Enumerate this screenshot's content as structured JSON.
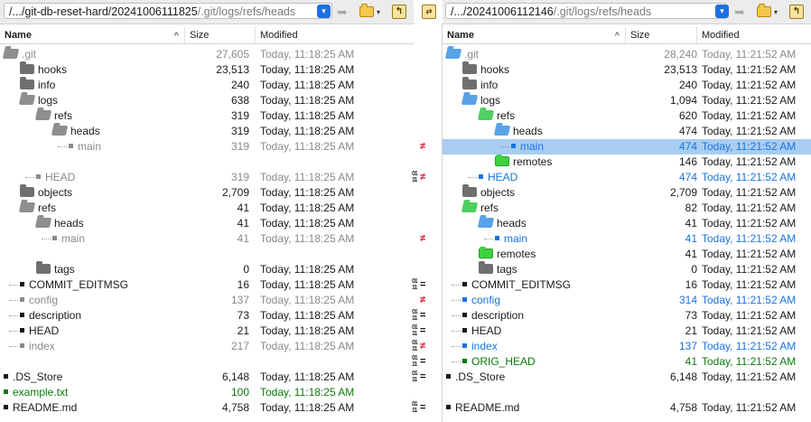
{
  "left_pane": {
    "path_prefix": "/.../git-db-reset-hard/20241006111825",
    "path_suffix": "/.git/logs/refs/heads",
    "rows": [
      {
        "name": ".git",
        "size": "27,605",
        "mod": "Today, 11:18:25 AM",
        "kind": "folder-open",
        "depth": 0,
        "style": "gray"
      },
      {
        "name": "hooks",
        "size": "23,513",
        "mod": "Today, 11:18:25 AM",
        "kind": "folder",
        "depth": 1,
        "style": "normal"
      },
      {
        "name": "info",
        "size": "240",
        "mod": "Today, 11:18:25 AM",
        "kind": "folder",
        "depth": 1,
        "style": "normal"
      },
      {
        "name": "logs",
        "size": "638",
        "mod": "Today, 11:18:25 AM",
        "kind": "folder-open",
        "depth": 1,
        "style": "normal"
      },
      {
        "name": "refs",
        "size": "319",
        "mod": "Today, 11:18:25 AM",
        "kind": "folder-open",
        "depth": 2,
        "style": "normal"
      },
      {
        "name": "heads",
        "size": "319",
        "mod": "Today, 11:18:25 AM",
        "kind": "folder-open",
        "depth": 3,
        "style": "normal"
      },
      {
        "name": "main",
        "size": "319",
        "mod": "Today, 11:18:25 AM",
        "kind": "file",
        "depth": 4,
        "style": "gray"
      },
      {
        "name": "",
        "size": "",
        "mod": "",
        "kind": "empty",
        "depth": 0,
        "style": "normal"
      },
      {
        "name": "HEAD",
        "size": "319",
        "mod": "Today, 11:18:25 AM",
        "kind": "file",
        "depth": 2,
        "style": "gray"
      },
      {
        "name": "objects",
        "size": "2,709",
        "mod": "Today, 11:18:25 AM",
        "kind": "folder",
        "depth": 1,
        "style": "normal"
      },
      {
        "name": "refs",
        "size": "41",
        "mod": "Today, 11:18:25 AM",
        "kind": "folder-open",
        "depth": 1,
        "style": "normal"
      },
      {
        "name": "heads",
        "size": "41",
        "mod": "Today, 11:18:25 AM",
        "kind": "folder-open",
        "depth": 2,
        "style": "normal"
      },
      {
        "name": "main",
        "size": "41",
        "mod": "Today, 11:18:25 AM",
        "kind": "file",
        "depth": 3,
        "style": "gray"
      },
      {
        "name": "",
        "size": "",
        "mod": "",
        "kind": "empty",
        "depth": 0,
        "style": "normal"
      },
      {
        "name": "tags",
        "size": "0",
        "mod": "Today, 11:18:25 AM",
        "kind": "folder",
        "depth": 2,
        "style": "normal"
      },
      {
        "name": "COMMIT_EDITMSG",
        "size": "16",
        "mod": "Today, 11:18:25 AM",
        "kind": "file",
        "depth": 1,
        "style": "normal"
      },
      {
        "name": "config",
        "size": "137",
        "mod": "Today, 11:18:25 AM",
        "kind": "file",
        "depth": 1,
        "style": "gray"
      },
      {
        "name": "description",
        "size": "73",
        "mod": "Today, 11:18:25 AM",
        "kind": "file",
        "depth": 1,
        "style": "normal"
      },
      {
        "name": "HEAD",
        "size": "21",
        "mod": "Today, 11:18:25 AM",
        "kind": "file",
        "depth": 1,
        "style": "normal"
      },
      {
        "name": "index",
        "size": "217",
        "mod": "Today, 11:18:25 AM",
        "kind": "file",
        "depth": 1,
        "style": "gray"
      },
      {
        "name": "",
        "size": "",
        "mod": "",
        "kind": "empty",
        "depth": 0,
        "style": "normal"
      },
      {
        "name": ".DS_Store",
        "size": "6,148",
        "mod": "Today, 11:18:25 AM",
        "kind": "file",
        "depth": 0,
        "style": "normal"
      },
      {
        "name": "example.txt",
        "size": "100",
        "mod": "Today, 11:18:25 AM",
        "kind": "file",
        "depth": 0,
        "style": "green"
      },
      {
        "name": "README.md",
        "size": "4,758",
        "mod": "Today, 11:18:25 AM",
        "kind": "file",
        "depth": 0,
        "style": "normal"
      }
    ]
  },
  "right_pane": {
    "path_prefix": "/.../20241006112146",
    "path_suffix": "/.git/logs/refs/heads",
    "rows": [
      {
        "name": ".git",
        "size": "28,240",
        "mod": "Today, 11:21:52 AM",
        "kind": "folder-open-blue",
        "depth": 0,
        "style": "gray"
      },
      {
        "name": "hooks",
        "size": "23,513",
        "mod": "Today, 11:21:52 AM",
        "kind": "folder",
        "depth": 1,
        "style": "normal"
      },
      {
        "name": "info",
        "size": "240",
        "mod": "Today, 11:21:52 AM",
        "kind": "folder",
        "depth": 1,
        "style": "normal"
      },
      {
        "name": "logs",
        "size": "1,094",
        "mod": "Today, 11:21:52 AM",
        "kind": "folder-open-blue",
        "depth": 1,
        "style": "normal"
      },
      {
        "name": "refs",
        "size": "620",
        "mod": "Today, 11:21:52 AM",
        "kind": "folder-open-green",
        "depth": 2,
        "style": "normal"
      },
      {
        "name": "heads",
        "size": "474",
        "mod": "Today, 11:21:52 AM",
        "kind": "folder-open-blue",
        "depth": 3,
        "style": "normal"
      },
      {
        "name": "main",
        "size": "474",
        "mod": "Today, 11:21:52 AM",
        "kind": "file",
        "depth": 4,
        "style": "blue",
        "selected": true
      },
      {
        "name": "remotes",
        "size": "146",
        "mod": "Today, 11:21:52 AM",
        "kind": "folder-green",
        "depth": 3,
        "style": "normal"
      },
      {
        "name": "HEAD",
        "size": "474",
        "mod": "Today, 11:21:52 AM",
        "kind": "file",
        "depth": 2,
        "style": "blue"
      },
      {
        "name": "objects",
        "size": "2,709",
        "mod": "Today, 11:21:52 AM",
        "kind": "folder",
        "depth": 1,
        "style": "normal"
      },
      {
        "name": "refs",
        "size": "82",
        "mod": "Today, 11:21:52 AM",
        "kind": "folder-open-green",
        "depth": 1,
        "style": "normal"
      },
      {
        "name": "heads",
        "size": "41",
        "mod": "Today, 11:21:52 AM",
        "kind": "folder-open-blue",
        "depth": 2,
        "style": "normal"
      },
      {
        "name": "main",
        "size": "41",
        "mod": "Today, 11:21:52 AM",
        "kind": "file",
        "depth": 3,
        "style": "blue"
      },
      {
        "name": "remotes",
        "size": "41",
        "mod": "Today, 11:21:52 AM",
        "kind": "folder-green",
        "depth": 2,
        "style": "normal"
      },
      {
        "name": "tags",
        "size": "0",
        "mod": "Today, 11:21:52 AM",
        "kind": "folder",
        "depth": 2,
        "style": "normal"
      },
      {
        "name": "COMMIT_EDITMSG",
        "size": "16",
        "mod": "Today, 11:21:52 AM",
        "kind": "file",
        "depth": 1,
        "style": "normal"
      },
      {
        "name": "config",
        "size": "314",
        "mod": "Today, 11:21:52 AM",
        "kind": "file",
        "depth": 1,
        "style": "blue"
      },
      {
        "name": "description",
        "size": "73",
        "mod": "Today, 11:21:52 AM",
        "kind": "file",
        "depth": 1,
        "style": "normal"
      },
      {
        "name": "HEAD",
        "size": "21",
        "mod": "Today, 11:21:52 AM",
        "kind": "file",
        "depth": 1,
        "style": "normal"
      },
      {
        "name": "index",
        "size": "137",
        "mod": "Today, 11:21:52 AM",
        "kind": "file",
        "depth": 1,
        "style": "blue"
      },
      {
        "name": "ORIG_HEAD",
        "size": "41",
        "mod": "Today, 11:21:52 AM",
        "kind": "file",
        "depth": 1,
        "style": "green"
      },
      {
        "name": ".DS_Store",
        "size": "6,148",
        "mod": "Today, 11:21:52 AM",
        "kind": "file",
        "depth": 0,
        "style": "normal"
      },
      {
        "name": "",
        "size": "",
        "mod": "",
        "kind": "empty",
        "depth": 0,
        "style": "normal"
      },
      {
        "name": "README.md",
        "size": "4,758",
        "mod": "Today, 11:21:52 AM",
        "kind": "file",
        "depth": 0,
        "style": "normal"
      }
    ]
  },
  "columns": {
    "name": "Name",
    "size": "Size",
    "modified": "Modified",
    "sort_indicator": "^"
  },
  "center_markers": [
    {
      "row": 6,
      "type": "neq"
    },
    {
      "row": 8,
      "type": "neq",
      "ctl": true
    },
    {
      "row": 12,
      "type": "neq"
    },
    {
      "row": 15,
      "type": "eq",
      "ctl": true
    },
    {
      "row": 16,
      "type": "neq"
    },
    {
      "row": 17,
      "type": "eq",
      "ctl": true
    },
    {
      "row": 18,
      "type": "eq",
      "ctl": true
    },
    {
      "row": 19,
      "type": "neq",
      "ctl": true
    },
    {
      "row": 20,
      "type": "eq",
      "ctl": true
    },
    {
      "row": 21,
      "type": "eq",
      "ctl": true
    },
    {
      "row": 23,
      "type": "eq",
      "ctl": true
    }
  ],
  "marker_glyphs": {
    "neq": "≠",
    "eq": "=",
    "ctl": "01\n11"
  },
  "icons": {
    "dropdown": "chevron-down-icon",
    "reload": "reload-arrow-icon",
    "folder": "folder-icon",
    "parent": "parent-folder-icon",
    "swap": "swap-icon"
  },
  "colors": {
    "blue": "#1a73e0",
    "green": "#0a7a0a",
    "gray": "#8a8a8a",
    "diff_red": "#e0182a",
    "selection": "#a9cdf0"
  }
}
